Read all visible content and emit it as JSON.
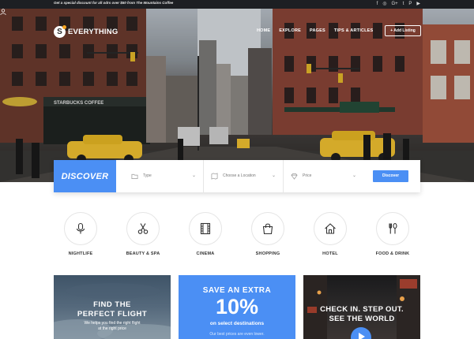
{
  "topbar": {
    "promo": "Get a special discount for all odrs over $50 from The Mountains Coffee",
    "socials": [
      "f",
      "◎",
      "G+",
      "t",
      "P",
      "▶"
    ]
  },
  "brand": {
    "mark": "S",
    "name": "EVERYTHING"
  },
  "nav": {
    "items": [
      "HOME",
      "EXPLORE",
      "PAGES",
      "TIPS & ARTICLES"
    ],
    "add_listing": "+ Add Listing"
  },
  "hero": {
    "sign_text": "STARBUCKS COFFEE"
  },
  "search": {
    "discover_label": "DISCOVER",
    "type_placeholder": "Type",
    "location_placeholder": "Choose a Location",
    "price_placeholder": "Price",
    "button_label": "Discover"
  },
  "categories": [
    {
      "label": "NIGHTLIFE",
      "icon": "microphone-icon"
    },
    {
      "label": "BEAUTY & SPA",
      "icon": "scissors-icon"
    },
    {
      "label": "CINEMA",
      "icon": "film-icon"
    },
    {
      "label": "SHOPPING",
      "icon": "shopping-bag-icon"
    },
    {
      "label": "HOTEL",
      "icon": "house-icon"
    },
    {
      "label": "FOOD & DRINK",
      "icon": "fork-spoon-icon"
    }
  ],
  "cards": {
    "flight": {
      "line1": "FIND THE",
      "line2": "PERFECT FLIGHT",
      "sub1": "We helps you find the right flight",
      "sub2": "at the right price"
    },
    "save": {
      "heading": "SAVE AN EXTRA",
      "big": "10%",
      "sub": "on select destinations",
      "note": "Our best prices are even lower."
    },
    "checkin": {
      "line1": "CHECK IN. STEP OUT.",
      "line2": "SEE THE WORLD"
    }
  },
  "colors": {
    "accent": "#4b8ff4",
    "topbar": "#1d1f23",
    "taxi": "#f2c230"
  }
}
